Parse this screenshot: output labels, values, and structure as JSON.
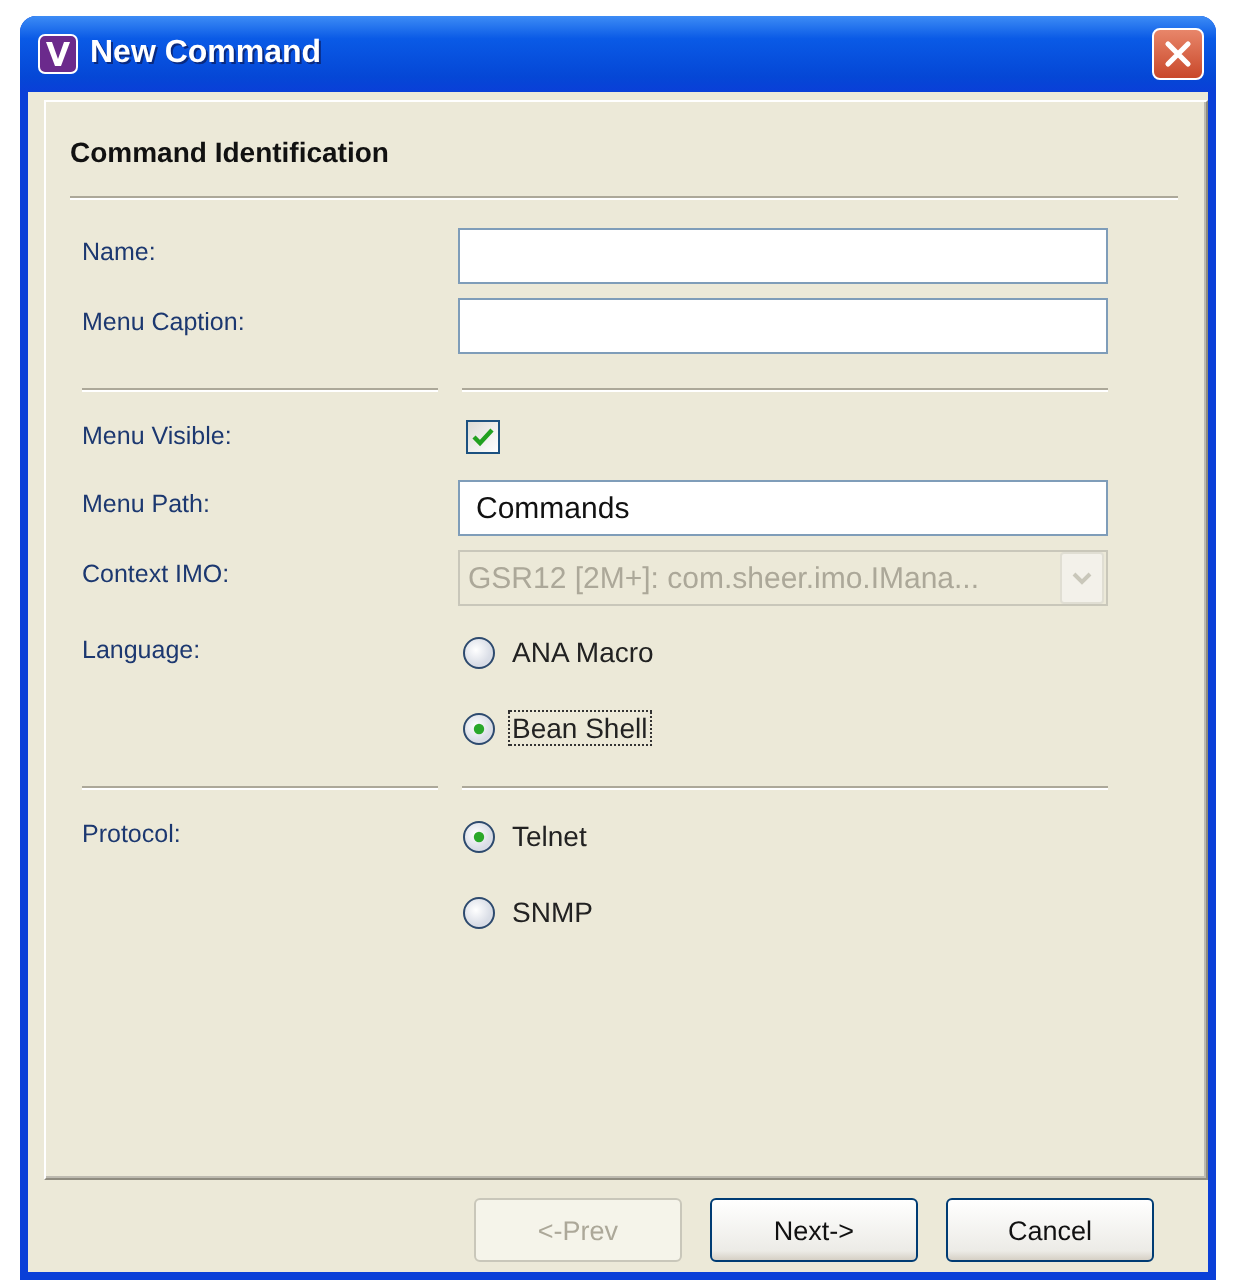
{
  "window": {
    "title": "New Command"
  },
  "section_title": "Command Identification",
  "rows": [
    {
      "kind": "field",
      "label": "Name:"
    },
    {
      "kind": "field",
      "label": "Menu Caption:"
    },
    {
      "kind": "separator"
    },
    {
      "kind": "checkbox",
      "label": "Menu Visible:",
      "checked": true
    },
    {
      "kind": "field",
      "label": "Menu Path:",
      "value": "Commands"
    },
    {
      "kind": "combo",
      "label": "Context IMO:",
      "value": "GSR12 [2M+]: com.sheer.imo.IMana...",
      "disabled": true
    },
    {
      "kind": "radios",
      "label": "Language:",
      "options": [
        {
          "label": "ANA Macro",
          "selected": false,
          "focused": false
        },
        {
          "label": "Bean Shell",
          "selected": true,
          "focused": true
        }
      ]
    },
    {
      "kind": "separator"
    },
    {
      "kind": "radios",
      "label": "Protocol:",
      "options": [
        {
          "label": "Telnet",
          "selected": true,
          "focused": false
        },
        {
          "label": "SNMP",
          "selected": false,
          "focused": false
        }
      ]
    }
  ],
  "buttons": [
    {
      "label": "<-Prev",
      "disabled": true
    },
    {
      "label": "Next->",
      "disabled": false
    },
    {
      "label": "Cancel",
      "disabled": false
    }
  ]
}
